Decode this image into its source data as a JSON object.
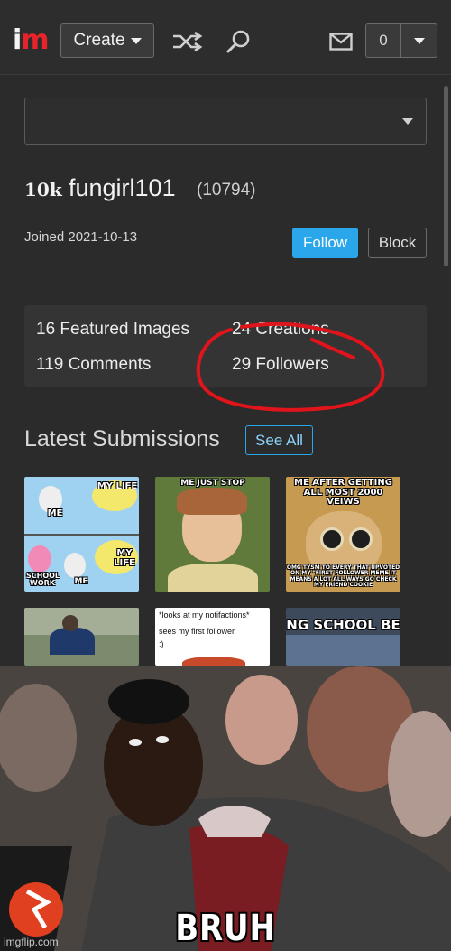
{
  "header": {
    "logo_i": "i",
    "logo_m": "m",
    "create_label": "Create",
    "notification_count": "0"
  },
  "profile": {
    "points_badge": "10k",
    "username": "fungirl101",
    "points": "(10794)",
    "joined": "Joined 2021-10-13",
    "follow_label": "Follow",
    "block_label": "Block"
  },
  "stats": {
    "featured": "16 Featured Images",
    "creations": "24 Creations",
    "comments": "119 Comments",
    "followers": "29 Followers"
  },
  "latest": {
    "title": "Latest Submissions",
    "see_all": "See All",
    "thumbs": [
      {
        "caps": [
          "MY LIFE",
          "ME",
          "MY LIFE",
          "SCHOOL WORK",
          "ME"
        ]
      },
      {
        "caps": [
          "ME JUST STOP"
        ]
      },
      {
        "caps": [
          "ME AFTER GETTING ALL MOST 2000 VEIWS",
          "OMG TYSM TO EVERY THAT UPVOTED ON MY \"FIRST FOLLOWER MEME IT MEANS A LOT ALL WAYS GO CHECK MY FRIEND COOKIE"
        ]
      },
      {
        "caps": []
      },
      {
        "caps": [
          "*looks at my notifactions*",
          "sees my first follower",
          ":)"
        ]
      },
      {
        "caps": [
          "NG SCHOOL BE"
        ]
      }
    ]
  },
  "meme": {
    "caption": "BRUH",
    "watermark": "imgflip.com"
  },
  "colors": {
    "accent_blue": "#2aa7ea",
    "logo_red": "#e8242a",
    "annotation_red": "#e0141b"
  }
}
